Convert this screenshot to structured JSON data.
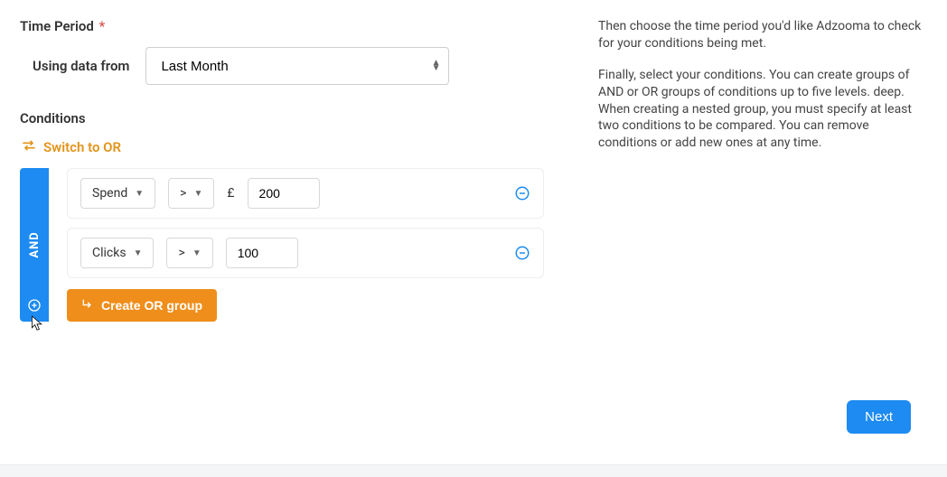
{
  "timePeriod": {
    "label": "Time Period",
    "required_marker": "*",
    "subLabel": "Using data from",
    "value": "Last Month"
  },
  "conditions": {
    "header": "Conditions",
    "switchLabel": "Switch to OR",
    "groupOperator": "AND",
    "rows": [
      {
        "metric": "Spend",
        "operator": ">",
        "currency": "£",
        "value": "200"
      },
      {
        "metric": "Clicks",
        "operator": ">",
        "currency": "",
        "value": "100"
      }
    ],
    "createOrLabel": "Create OR group"
  },
  "help": {
    "p1": "Then choose the time period you'd like Adzooma to check for your conditions being met.",
    "p2": "Finally, select your conditions. You can create groups of AND or OR groups of conditions up to five levels. deep. When creating a nested group, you must specify at least two conditions to be compared. You can remove conditions or add new ones at any time."
  },
  "nextLabel": "Next"
}
